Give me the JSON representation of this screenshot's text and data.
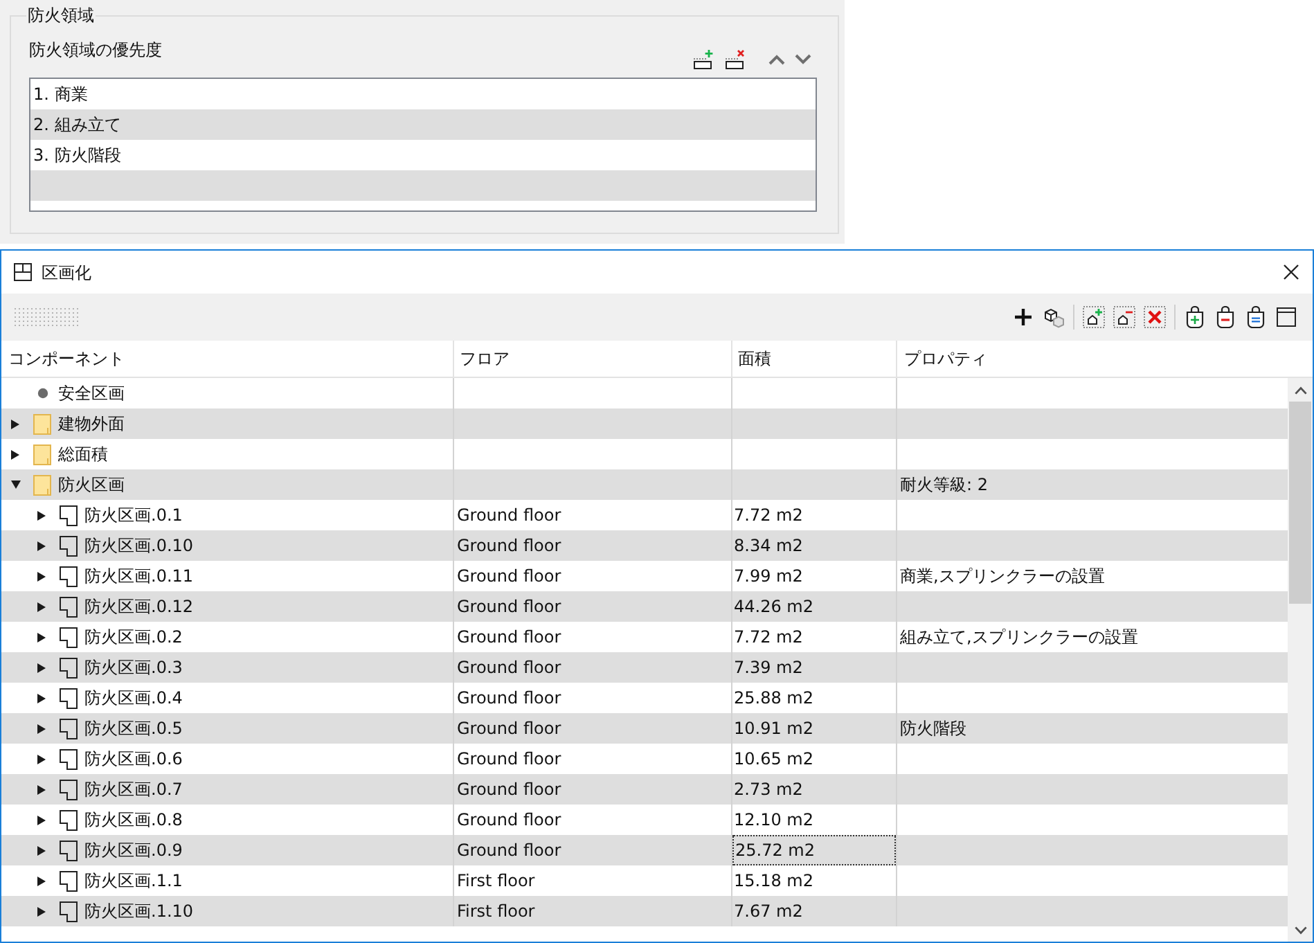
{
  "priority_panel": {
    "title": "防火領域",
    "label": "防火領域の優先度",
    "items": [
      "1. 商業",
      "2. 組み立て",
      "3. 防火階段"
    ]
  },
  "window": {
    "title": "区画化"
  },
  "table": {
    "columns": [
      "コンポーネント",
      "フロア",
      "面積",
      "プロパティ"
    ],
    "rows": [
      {
        "name": "安全区画",
        "kind": "bullet",
        "expandable": false,
        "area_focused": false
      },
      {
        "name": "建物外面",
        "kind": "folder",
        "expandable": true,
        "expanded": false,
        "area_focused": false
      },
      {
        "name": "総面積",
        "kind": "folder",
        "expandable": true,
        "expanded": false,
        "area_focused": false
      },
      {
        "name": "防火区画",
        "kind": "folder",
        "expandable": true,
        "expanded": true,
        "properties": "耐火等級: 2",
        "area_focused": false,
        "children": [
          {
            "name": "防火区画.0.1",
            "kind": "zone",
            "expandable": true,
            "expanded": false,
            "floor": "Ground floor",
            "area": "7.72 m2",
            "area_focused": false
          },
          {
            "name": "防火区画.0.10",
            "kind": "zone",
            "expandable": true,
            "expanded": false,
            "floor": "Ground floor",
            "area": "8.34 m2",
            "area_focused": false
          },
          {
            "name": "防火区画.0.11",
            "kind": "zone",
            "expandable": true,
            "expanded": false,
            "floor": "Ground floor",
            "area": "7.99 m2",
            "properties": "商業,スプリンクラーの設置",
            "area_focused": false
          },
          {
            "name": "防火区画.0.12",
            "kind": "zone",
            "expandable": true,
            "expanded": false,
            "floor": "Ground floor",
            "area": "44.26 m2",
            "area_focused": false
          },
          {
            "name": "防火区画.0.2",
            "kind": "zone",
            "expandable": true,
            "expanded": false,
            "floor": "Ground floor",
            "area": "7.72 m2",
            "properties": "組み立て,スプリンクラーの設置",
            "area_focused": false
          },
          {
            "name": "防火区画.0.3",
            "kind": "zone",
            "expandable": true,
            "expanded": false,
            "floor": "Ground floor",
            "area": "7.39 m2",
            "area_focused": false
          },
          {
            "name": "防火区画.0.4",
            "kind": "zone",
            "expandable": true,
            "expanded": false,
            "floor": "Ground floor",
            "area": "25.88 m2",
            "area_focused": false
          },
          {
            "name": "防火区画.0.5",
            "kind": "zone",
            "expandable": true,
            "expanded": false,
            "floor": "Ground floor",
            "area": "10.91 m2",
            "properties": "防火階段",
            "area_focused": false
          },
          {
            "name": "防火区画.0.6",
            "kind": "zone",
            "expandable": true,
            "expanded": false,
            "floor": "Ground floor",
            "area": "10.65 m2",
            "area_focused": false
          },
          {
            "name": "防火区画.0.7",
            "kind": "zone",
            "expandable": true,
            "expanded": false,
            "floor": "Ground floor",
            "area": "2.73 m2",
            "area_focused": false
          },
          {
            "name": "防火区画.0.8",
            "kind": "zone",
            "expandable": true,
            "expanded": false,
            "floor": "Ground floor",
            "area": "12.10 m2",
            "area_focused": false
          },
          {
            "name": "防火区画.0.9",
            "kind": "zone",
            "expandable": true,
            "expanded": false,
            "floor": "Ground floor",
            "area": "25.72 m2",
            "area_focused": true
          },
          {
            "name": "防火区画.1.1",
            "kind": "zone",
            "expandable": true,
            "expanded": false,
            "floor": "First floor",
            "area": "15.18 m2",
            "area_focused": false
          },
          {
            "name": "防火区画.1.10",
            "kind": "zone",
            "expandable": true,
            "expanded": false,
            "floor": "First floor",
            "area": "7.67 m2",
            "area_focused": false
          }
        ]
      }
    ]
  }
}
